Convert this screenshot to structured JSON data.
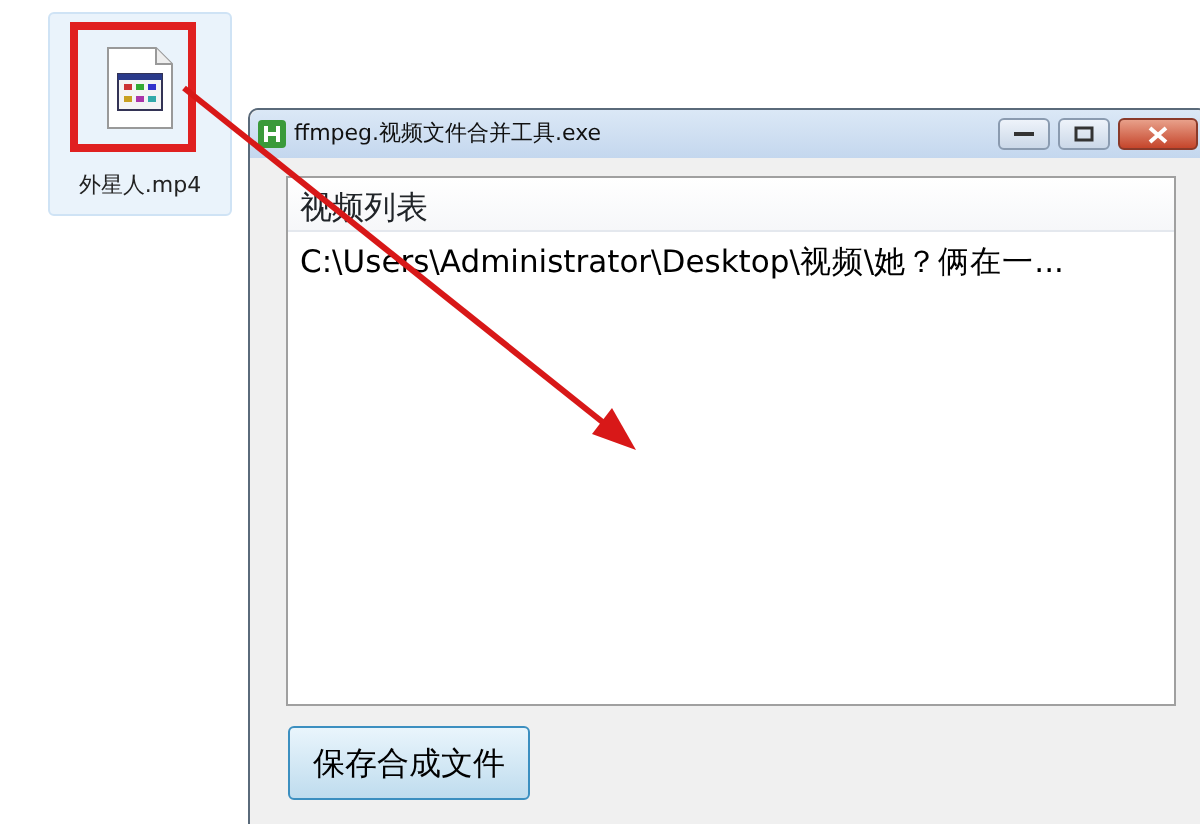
{
  "desktop_icons": [
    {
      "label": "外星人.mp4",
      "selected": true
    }
  ],
  "window": {
    "title": "ffmpeg.视频文件合并工具.exe"
  },
  "video_list": {
    "header": "视频列表",
    "items": [
      "C:\\Users\\Administrator\\Desktop\\视频\\她？俩在一..."
    ]
  },
  "save_button": "保存合成文件"
}
